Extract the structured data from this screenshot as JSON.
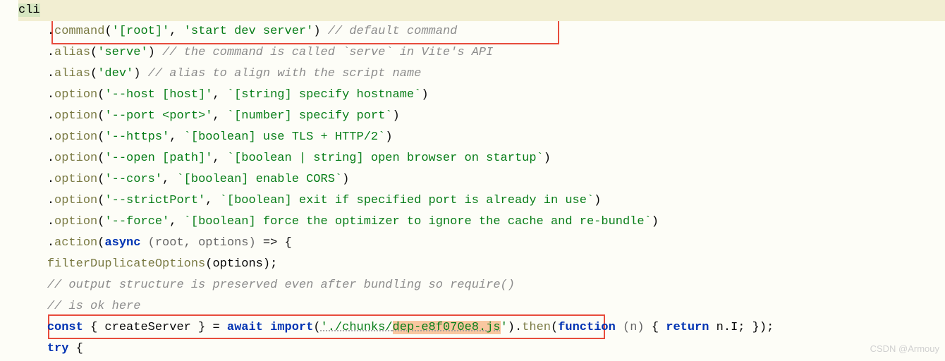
{
  "lines": {
    "l1": {
      "cli": "cli"
    },
    "l2": {
      "method": "command",
      "arg1": "'[root]'",
      "arg2": "'start dev server'",
      "comment": "// default command"
    },
    "l3": {
      "method": "alias",
      "arg1": "'serve'",
      "comment": "// the command is called `serve` in Vite's API"
    },
    "l4": {
      "method": "alias",
      "arg1": "'dev'",
      "comment": "// alias to align with the script name"
    },
    "l5": {
      "method": "option",
      "arg1": "'--host [host]'",
      "arg2": "`[string] specify hostname`"
    },
    "l6": {
      "method": "option",
      "arg1": "'--port <port>'",
      "arg2": "`[number] specify port`"
    },
    "l7": {
      "method": "option",
      "arg1": "'--https'",
      "arg2": "`[boolean] use TLS + HTTP/2`"
    },
    "l8": {
      "method": "option",
      "arg1": "'--open [path]'",
      "arg2": "`[boolean | string] open browser on startup`"
    },
    "l9": {
      "method": "option",
      "arg1": "'--cors'",
      "arg2": "`[boolean] enable CORS`"
    },
    "l10": {
      "method": "option",
      "arg1": "'--strictPort'",
      "arg2": "`[boolean] exit if specified port is already in use`"
    },
    "l11": {
      "method": "option",
      "arg1": "'--force'",
      "arg2": "`[boolean] force the optimizer to ignore the cache and re-bundle`"
    },
    "l12": {
      "method": "action",
      "kw": "async",
      "params": "(root, options)",
      "arrow": "=> {"
    },
    "l13": {
      "fn": "filterDuplicateOptions",
      "arg": "options"
    },
    "l14": {
      "comment": "// output structure is preserved even after bundling so require()"
    },
    "l15": {
      "comment": "// is ok here"
    },
    "l16": {
      "kw1": "const",
      "destr": "{ createServer }",
      "eq": " = ",
      "kw2": "await",
      "imp": " import",
      "path_pre": "'./chunks/",
      "path_hl": "dep-e8f070e8.js",
      "path_post": "'",
      "then": "then",
      "kw3": "function",
      "param": "(n)",
      "body": "{ ",
      "kw4": "return",
      "expr": " n.I; });"
    },
    "l17": {
      "kw": "try",
      "brace": " {"
    }
  },
  "watermark": "CSDN @Armouy"
}
